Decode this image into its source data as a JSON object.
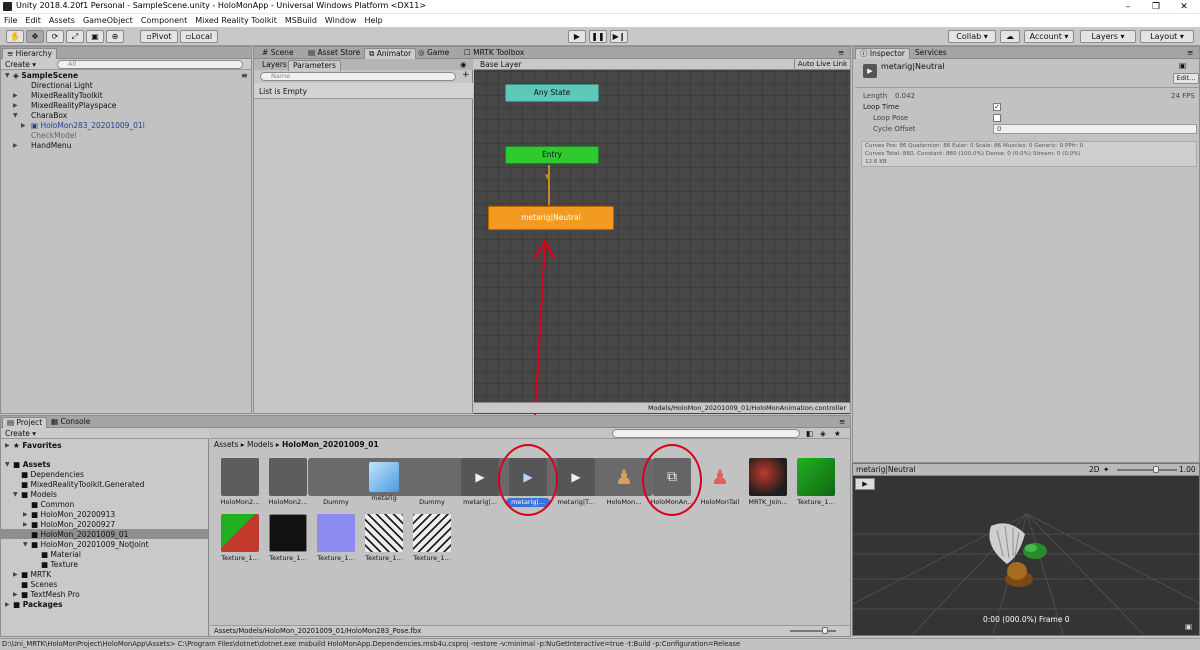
{
  "window": {
    "title": "Unity 2018.4.20f1 Personal - SampleScene.unity - HoloMonApp - Universal Windows Platform <DX11>",
    "minimize": "–",
    "maximize": "❐",
    "close": "✕"
  },
  "menu": [
    "File",
    "Edit",
    "Assets",
    "GameObject",
    "Component",
    "Mixed Reality Toolkit",
    "MSBuild",
    "Window",
    "Help"
  ],
  "toolbar": {
    "pivot": "Pivot",
    "local": "Local",
    "collab": "Collab ▾",
    "account": "Account",
    "layers": "Layers",
    "layout": "Layout"
  },
  "hierarchy": {
    "tab": "Hierarchy",
    "create": "Create ▾",
    "search_placeholder": "All",
    "scene": "SampleScene",
    "items": [
      "Directional Light",
      "MixedRealityToolkit",
      "MixedRealityPlayspace",
      "CharaBox",
      "HoloMon283_20201009_01l",
      "CheckModel",
      "HandMenu"
    ]
  },
  "center_tabs": [
    "Scene",
    "Asset Store",
    "Animator",
    "Game",
    "MRTK Toolbox"
  ],
  "animator": {
    "layers_tab": "Layers",
    "parameters_tab": "Parameters",
    "search_placeholder": "Name",
    "list_empty": "List is Empty",
    "base_layer": "Base Layer",
    "auto_live": "Auto Live Link",
    "states": {
      "any": "Any State",
      "entry": "Entry",
      "neutral": "metarig|Neutral"
    },
    "path": "Models/HoloMon_20201009_01/HoloMonAnimation.controller"
  },
  "inspector": {
    "tab": "Inspector",
    "services": "Services",
    "name": "metarig|Neutral",
    "edit": "Edit...",
    "length_label": "Length",
    "length_value": "0.042",
    "fps": "24 FPS",
    "loop_time": "Loop Time",
    "loop_pose": "Loop Pose",
    "cycle_offset": "Cycle Offset",
    "cycle_value": "0",
    "stats1": "Curves Pos: 86 Quaternion: 86 Euler: 0 Scale: 86 Muscles: 0 Generic: 0 PPtr: 0",
    "stats2": "Curves Total: 860, Constant: 860 (100.0%) Dense: 0 (0.0%) Stream: 0 (0.0%)",
    "stats3": "12.6 KB"
  },
  "preview": {
    "title": "metarig|Neutral",
    "mode": "2D",
    "speed": "1.00",
    "frame": "0:00 (000.0%) Frame 0"
  },
  "project": {
    "tab": "Project",
    "console": "Console",
    "create": "Create ▾",
    "favorites": "Favorites",
    "assets": "Assets",
    "tree": [
      "Dependencies",
      "MixedRealityToolkit.Generated",
      "Models",
      "Common",
      "HoloMon_20200913",
      "HoloMon_20200927",
      "HoloMon_20201009_01",
      "HoloMon_20201009_NotJoint",
      "Material",
      "Texture",
      "MRTK",
      "Scenes",
      "TextMesh Pro"
    ],
    "packages": "Packages",
    "breadcrumb": [
      "Assets",
      "Models",
      "HoloMon_20201009_01"
    ],
    "assets_row1": [
      "HoloMon2...",
      "HoloMon2...",
      "Dummy",
      "metarig",
      "Dummy",
      "metarig|...",
      "metarig|...",
      "metarig|T...",
      "HoloMon...",
      "HoloMonAn...",
      "HoloMonTail",
      "MRTK_Join...",
      "Texture_1..."
    ],
    "assets_row2": [
      "Texture_1...",
      "Texture_1...",
      "Texture_1...",
      "Texture_1...",
      "Texture_1..."
    ],
    "footer": "Assets/Models/HoloMon_20201009_01/HoloMon283_Pose.fbx"
  },
  "statusbar": "D:\\Uni_MRTK\\HoloMonProject\\HoloMonApp\\Assets> C:\\Program Files\\dotnet\\dotnet.exe msbuild HoloMonApp.Dependencies.msb4u.csproj -restore -v:minimal -p:NuGetInteractive=true -t:Build -p:Configuration=Release"
}
